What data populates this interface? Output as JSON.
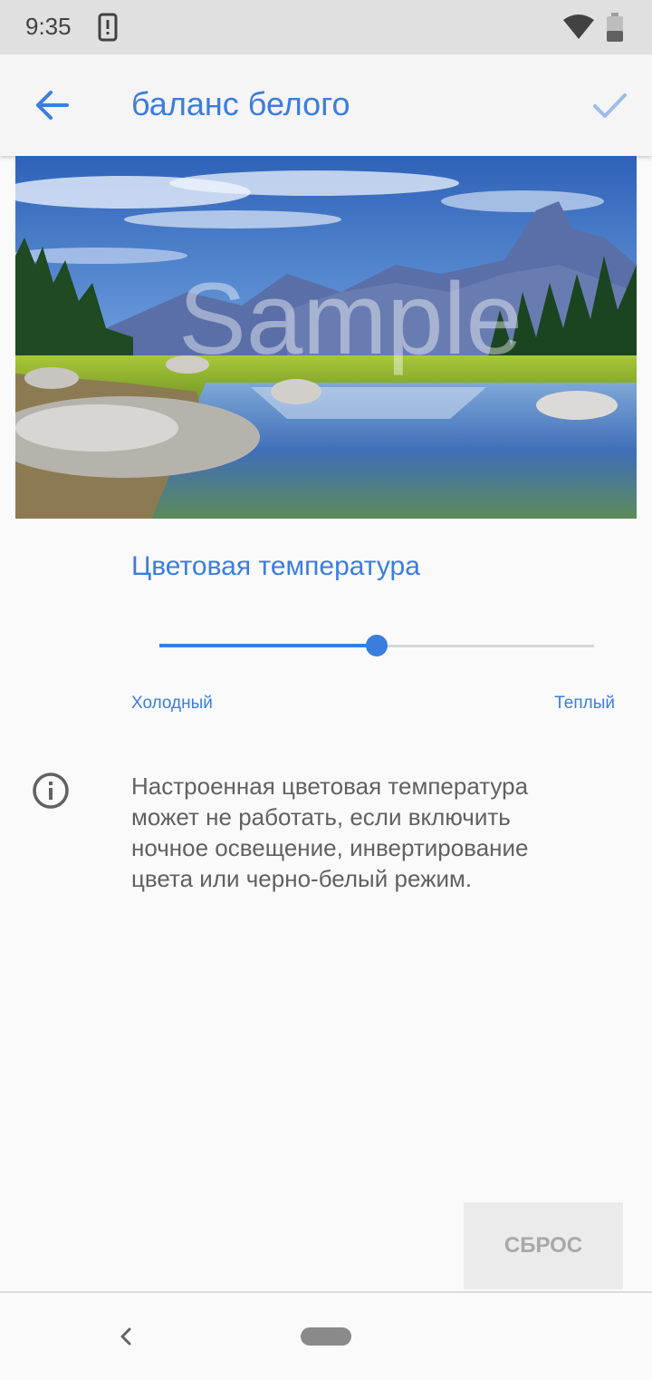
{
  "status_bar": {
    "time": "9:35",
    "icons": [
      "notification-icon",
      "wifi-icon",
      "battery-icon"
    ]
  },
  "toolbar": {
    "title": "баланс белого",
    "back_icon": "arrow-back-icon",
    "confirm_icon": "check-icon"
  },
  "preview": {
    "watermark": "Sample"
  },
  "color_temperature": {
    "title": "Цветовая температура",
    "min_label": "Холодный",
    "max_label": "Теплый",
    "value": 0.5
  },
  "info": {
    "icon": "info-icon",
    "text": "Настроенная цветовая температура может не работать, если включить ночное освещение, инвертирование цвета или черно-белый режим."
  },
  "actions": {
    "reset_label": "СБРОС"
  },
  "colors": {
    "accent": "#3b7ddd",
    "toolbar_bg": "#f5f5f5",
    "status_bar_bg": "#e0e0e0",
    "page_bg": "#fafafa",
    "disabled_text": "#a8a8a8"
  }
}
